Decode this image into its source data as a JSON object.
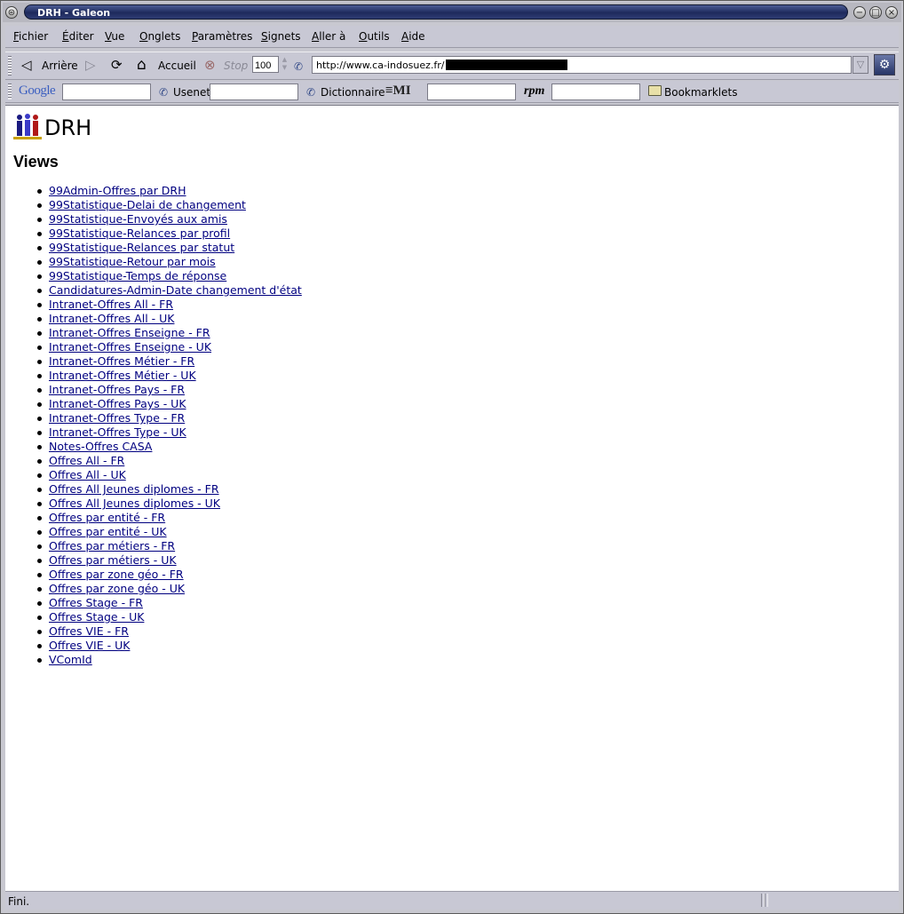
{
  "window": {
    "title": "DRH - Galeon",
    "menu_button_glyph": "⊜",
    "min_glyph": "−",
    "max_glyph": "□",
    "close_glyph": "×"
  },
  "menubar": {
    "items": [
      "Fichier",
      "Éditer",
      "Vue",
      "Onglets",
      "Paramètres",
      "Signets",
      "Aller à",
      "Outils",
      "Aide"
    ]
  },
  "toolbar": {
    "back_label": "Arrière",
    "home_label": "Accueil",
    "stop_label": "Stop",
    "zoom_value": "100",
    "url_value": "http://www.ca-indosuez.fr/",
    "back_icon": "◁",
    "forward_icon": "▷",
    "reload_icon": "⟳",
    "home_icon": "⌂",
    "stop_icon": "⊗",
    "url_icon": "✆",
    "dropdown_icon": "▽",
    "spin_up": "▲",
    "spin_down": "▼",
    "throbber_icon": "⚙"
  },
  "searchbar": {
    "google_logo": "Google",
    "usenet_label": "Usenet",
    "dict_label": "Dictionnaire",
    "emi_logo": "≡MI",
    "rpm_logo": "rpm",
    "bookmarklets_label": "Bookmarklets",
    "small_icon": "✆",
    "folder_icon": "὜0"
  },
  "page": {
    "title": "DRH",
    "heading": "Views",
    "views": [
      "99Admin-Offres par DRH",
      "99Statistique-Delai de changement",
      "99Statistique-Envoyés aux amis",
      "99Statistique-Relances par profil",
      "99Statistique-Relances par statut",
      "99Statistique-Retour par mois",
      "99Statistique-Temps de réponse",
      "Candidatures-Admin-Date changement d'état",
      "Intranet-Offres All - FR",
      "Intranet-Offres All - UK",
      "Intranet-Offres Enseigne - FR",
      "Intranet-Offres Enseigne - UK",
      "Intranet-Offres Métier - FR",
      "Intranet-Offres Métier - UK",
      "Intranet-Offres Pays - FR",
      "Intranet-Offres Pays - UK",
      "Intranet-Offres Type - FR",
      "Intranet-Offres Type - UK",
      "Notes-Offres CASA",
      "Offres All - FR",
      "Offres All - UK",
      "Offres All Jeunes diplomes - FR",
      "Offres All Jeunes diplomes - UK",
      "Offres par entité - FR",
      "Offres par entité - UK",
      "Offres par métiers - FR",
      "Offres par métiers - UK",
      "Offres par zone géo - FR",
      "Offres par zone géo - UK",
      "Offres Stage - FR",
      "Offres Stage - UK",
      "Offres VIE - FR",
      "Offres VIE - UK",
      "VComId"
    ]
  },
  "status": {
    "text": "Fini."
  }
}
